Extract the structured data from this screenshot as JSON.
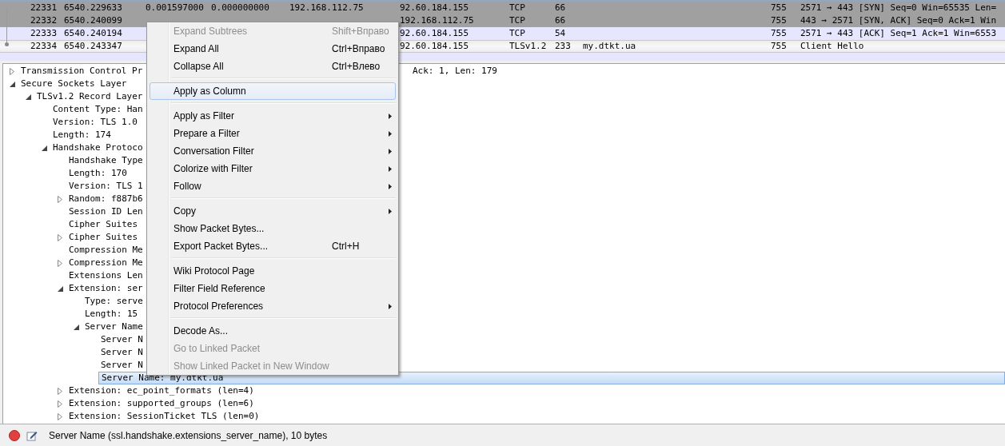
{
  "packet_list": {
    "rows": [
      {
        "color": "#a0a0a0",
        "selected": false,
        "column_1": "22331",
        "column_2": "6540.229633",
        "column_3": "0.001597000",
        "column_4": "0.000000000",
        "column_5": "192.168.112.75",
        "column_6": "92.60.184.155",
        "column_7": "TCP",
        "column_8": "66",
        "column_10": "755",
        "column_11": "2571 → 443 [SYN] Seq=0 Win=65535 Len="
      },
      {
        "color": "#a0a0a0",
        "selected": false,
        "column_1": "22332",
        "column_2": "6540.240099",
        "column_6": "192.168.112.75",
        "column_7": "TCP",
        "column_8": "66",
        "column_10": "755",
        "column_11": "443 → 2571 [SYN, ACK] Seq=0 Ack=1 Win"
      },
      {
        "color": "#e7e6ff",
        "selected": false,
        "column_1": "22333",
        "column_2": "6540.240194",
        "column_6": "92.60.184.155",
        "column_7": "TCP",
        "column_8": "54",
        "column_10": "755",
        "column_11": "2571 → 443 [ACK] Seq=1 Ack=1 Win=6553"
      },
      {
        "color": "#ececec",
        "selected": true,
        "column_1": "22334",
        "column_2": "6540.243347",
        "column_6": "92.60.184.155",
        "column_7": "TLSv1.2",
        "column_8": "233",
        "column_9": "my.dtkt.ua",
        "column_10": "755",
        "column_11": "Client Hello"
      },
      {
        "color": "#e7e6ff",
        "selected": false
      }
    ]
  },
  "tree": [
    {
      "label": "Transmission Control Pr",
      "tail": "Ack: 1, Len: 179",
      "expanded": false,
      "selected": false
    },
    {
      "label": "Secure Sockets Layer",
      "expanded": true,
      "selected": false,
      "children": [
        {
          "label": "TLSv1.2 Record Layer",
          "expanded": true,
          "selected": false,
          "children": [
            {
              "label": "Content Type: Han",
              "selected": false
            },
            {
              "label": "Version: TLS 1.0",
              "selected": false
            },
            {
              "label": "Length: 174",
              "selected": false
            },
            {
              "label": "Handshake Protoco",
              "expanded": true,
              "selected": false,
              "children": [
                {
                  "label": "Handshake Type",
                  "selected": false
                },
                {
                  "label": "Length: 170",
                  "selected": false
                },
                {
                  "label": "Version: TLS 1",
                  "selected": false
                },
                {
                  "label": "Random: f887b6",
                  "expanded": false,
                  "selected": false
                },
                {
                  "label": "Session ID Len",
                  "selected": false
                },
                {
                  "label": "Cipher Suites",
                  "selected": false
                },
                {
                  "label": "Cipher Suites",
                  "expanded": false,
                  "selected": false
                },
                {
                  "label": "Compression Me",
                  "selected": false
                },
                {
                  "label": "Compression Me",
                  "expanded": false,
                  "selected": false
                },
                {
                  "label": "Extensions Len",
                  "selected": false
                },
                {
                  "label": "Extension: ser",
                  "expanded": true,
                  "selected": false,
                  "children": [
                    {
                      "label": "Type: serve",
                      "selected": false
                    },
                    {
                      "label": "Length: 15",
                      "selected": false
                    },
                    {
                      "label": "Server Name",
                      "expanded": true,
                      "selected": false,
                      "children": [
                        {
                          "label": "Server N",
                          "selected": false
                        },
                        {
                          "label": "Server N",
                          "selected": false
                        },
                        {
                          "label": "Server N",
                          "selected": false
                        },
                        {
                          "label": "Server Name: my.dtkt.ua",
                          "selected": true
                        }
                      ]
                    }
                  ]
                },
                {
                  "label": "Extension: ec_point_formats (len=4)",
                  "expanded": false,
                  "selected": false
                },
                {
                  "label": "Extension: supported_groups (len=6)",
                  "expanded": false,
                  "selected": false
                },
                {
                  "label": "Extension: SessionTicket TLS (len=0)",
                  "expanded": false,
                  "selected": false
                }
              ]
            }
          ]
        }
      ]
    }
  ],
  "context_menu": {
    "items": [
      {
        "kind": "item",
        "label": "Expand Subtrees",
        "shortcut": "Shift+Вправо",
        "disabled": true,
        "selected": false,
        "submenu": false
      },
      {
        "kind": "item",
        "label": "Expand All",
        "shortcut": "Ctrl+Вправо",
        "disabled": false,
        "selected": false,
        "submenu": false
      },
      {
        "kind": "item",
        "label": "Collapse All",
        "shortcut": "Ctrl+Влево",
        "disabled": false,
        "selected": false,
        "submenu": false
      },
      {
        "kind": "separator"
      },
      {
        "kind": "item",
        "label": "Apply as Column",
        "disabled": false,
        "selected": true,
        "submenu": false
      },
      {
        "kind": "separator"
      },
      {
        "kind": "item",
        "label": "Apply as Filter",
        "disabled": false,
        "selected": false,
        "submenu": true
      },
      {
        "kind": "item",
        "label": "Prepare a Filter",
        "disabled": false,
        "selected": false,
        "submenu": true
      },
      {
        "kind": "item",
        "label": "Conversation Filter",
        "disabled": false,
        "selected": false,
        "submenu": true
      },
      {
        "kind": "item",
        "label": "Colorize with Filter",
        "disabled": false,
        "selected": false,
        "submenu": true
      },
      {
        "kind": "item",
        "label": "Follow",
        "disabled": false,
        "selected": false,
        "submenu": true
      },
      {
        "kind": "separator"
      },
      {
        "kind": "item",
        "label": "Copy",
        "disabled": false,
        "selected": false,
        "submenu": true
      },
      {
        "kind": "item",
        "label": "Show Packet Bytes...",
        "disabled": false,
        "selected": false,
        "submenu": false
      },
      {
        "kind": "item",
        "label": "Export Packet Bytes...",
        "shortcut": "Ctrl+H",
        "disabled": false,
        "selected": false,
        "submenu": false
      },
      {
        "kind": "separator"
      },
      {
        "kind": "item",
        "label": "Wiki Protocol Page",
        "disabled": false,
        "selected": false,
        "submenu": false
      },
      {
        "kind": "item",
        "label": "Filter Field Reference",
        "disabled": false,
        "selected": false,
        "submenu": false
      },
      {
        "kind": "item",
        "label": "Protocol Preferences",
        "disabled": false,
        "selected": false,
        "submenu": true
      },
      {
        "kind": "separator"
      },
      {
        "kind": "item",
        "label": "Decode As...",
        "disabled": false,
        "selected": false,
        "submenu": false
      },
      {
        "kind": "item",
        "label": "Go to Linked Packet",
        "disabled": true,
        "selected": false,
        "submenu": false
      },
      {
        "kind": "item",
        "label": "Show Linked Packet in New Window",
        "disabled": true,
        "selected": false,
        "submenu": false
      }
    ]
  },
  "status_bar": {
    "text": "Server Name (ssl.handshake.extensions_server_name), 10 bytes"
  }
}
